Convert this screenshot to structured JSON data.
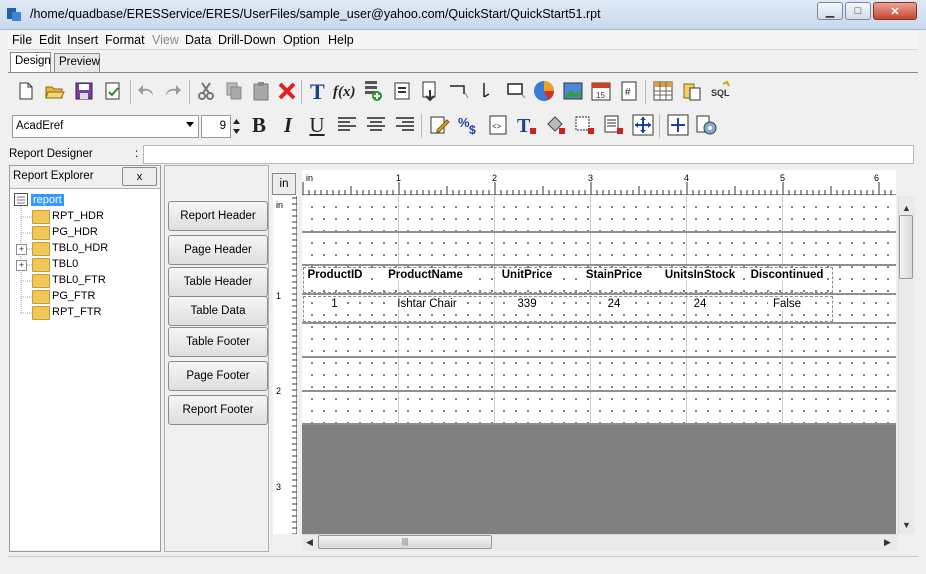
{
  "window": {
    "title": "/home/quadbase/ERESService/ERES/UserFiles/sample_user@yahoo.com/QuickStart/QuickStart51.rpt",
    "minimize_glyph": "▁",
    "maximize_glyph": "□",
    "close_glyph": "✕"
  },
  "menu": [
    {
      "label": "File"
    },
    {
      "label": "Edit"
    },
    {
      "label": "Insert"
    },
    {
      "label": "Format"
    },
    {
      "label": "View"
    },
    {
      "label": "Data"
    },
    {
      "label": "Drill-Down"
    },
    {
      "label": "Option"
    },
    {
      "label": "Help"
    }
  ],
  "tabs": [
    {
      "label": "Design"
    },
    {
      "label": "Preview"
    }
  ],
  "format_bar": {
    "font": "AcadEref",
    "size": "9",
    "bold_glyph": "B",
    "italic_glyph": "I",
    "underline_glyph": "U"
  },
  "designer": {
    "label": "Report Designer",
    "colon": ":"
  },
  "explorer": {
    "title": "Report Explorer",
    "close_label": "x",
    "tree": [
      {
        "label": "report"
      },
      {
        "label": "RPT_HDR"
      },
      {
        "label": "PG_HDR"
      },
      {
        "label": "TBL0_HDR"
      },
      {
        "label": "TBL0"
      },
      {
        "label": "TBL0_FTR"
      },
      {
        "label": "PG_FTR"
      },
      {
        "label": "RPT_FTR"
      }
    ]
  },
  "bands": [
    {
      "label": "Report Header"
    },
    {
      "label": "Page Header"
    },
    {
      "label": "Table Header"
    },
    {
      "label": "Table Data"
    },
    {
      "label": "Table Footer"
    },
    {
      "label": "Page Footer"
    },
    {
      "label": "Report Footer"
    }
  ],
  "ruler": {
    "unit_button": "in",
    "corner_label": "in",
    "h_marks": [
      "in",
      "1",
      "2",
      "3",
      "4",
      "5",
      "6"
    ],
    "v_marks": [
      "in",
      "1",
      "2",
      "3"
    ]
  },
  "table": {
    "headers": [
      "ProductID",
      "ProductName",
      "UnitPrice",
      "StainPrice",
      "UnitsInStock",
      "Discontinued"
    ],
    "row": [
      "1",
      "Ishtar Chair",
      "339",
      "24",
      "24",
      "False"
    ]
  },
  "scroll": {
    "hgrip": "|||"
  }
}
